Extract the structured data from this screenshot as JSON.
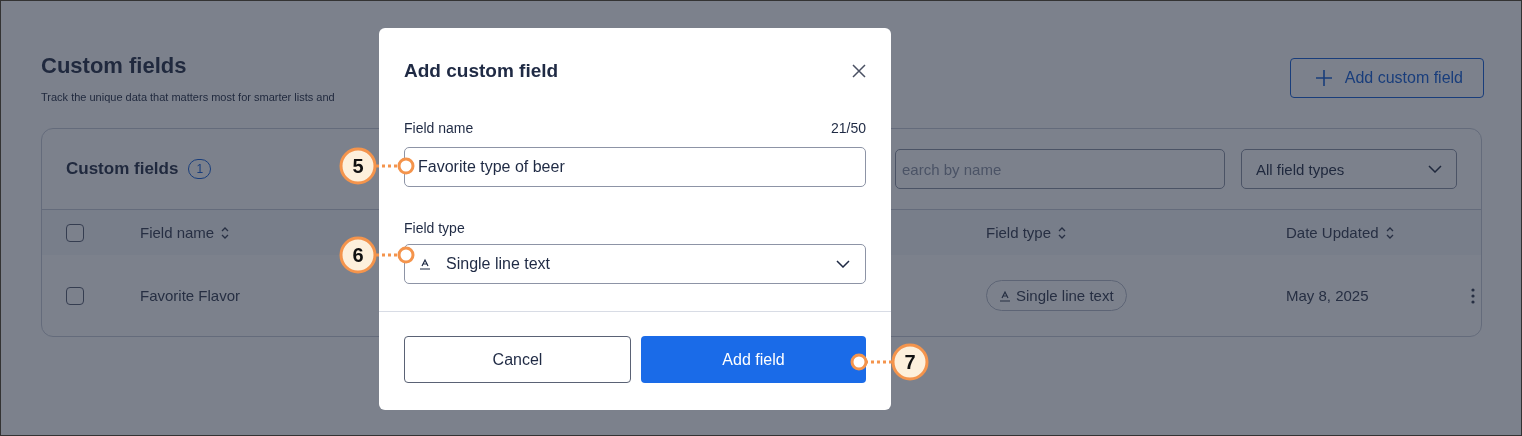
{
  "page": {
    "title": "Custom fields",
    "subtitle": "Track the unique data that matters most for smarter lists and",
    "add_button": "Add custom field"
  },
  "card": {
    "title": "Custom fields",
    "count": "1",
    "search": {
      "placeholder": "earch by name"
    },
    "type_filter": "All field types",
    "columns": [
      {
        "label": "Field name"
      },
      {
        "label": "Field type"
      },
      {
        "label": "Date Updated"
      }
    ],
    "rows": [
      {
        "checked": false,
        "name": "Favorite Flavor",
        "type": "Single line text",
        "date": "May 8, 2025"
      }
    ],
    "header_checked": false
  },
  "dialog": {
    "title": "Add custom field",
    "name_label": "Field name",
    "counter": "21/50",
    "name_value": "Favorite type of beer",
    "type_label": "Field type",
    "type_value": "Single line text",
    "cancel": "Cancel",
    "submit": "Add field"
  },
  "callouts": [
    {
      "label": "5"
    },
    {
      "label": "6"
    },
    {
      "label": "7"
    }
  ]
}
